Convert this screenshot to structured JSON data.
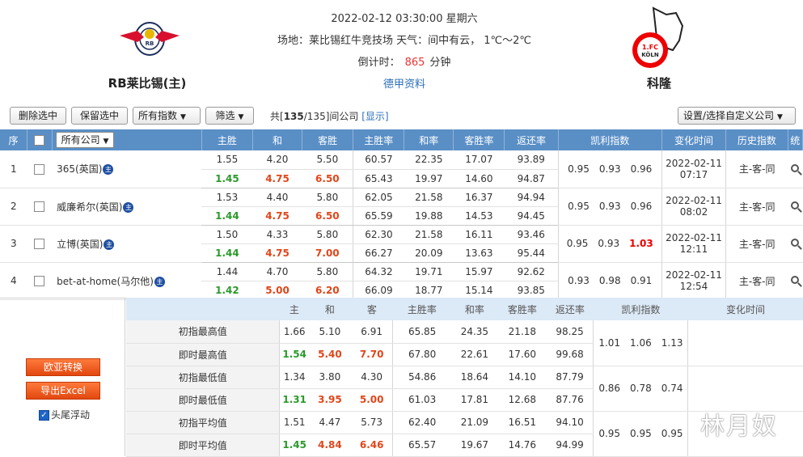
{
  "match": {
    "datetime": "2022-02-12 03:30:00 星期六",
    "venue_line": "场地：莱比锡红牛竞技场 天气：间中有云， 1℃～2℃",
    "countdown_label": "倒计时：",
    "countdown_value": "865",
    "countdown_unit": "分钟",
    "link": "德甲资料"
  },
  "home": {
    "name": "RB莱比锡(主)",
    "logo": "rb-leipzig-logo"
  },
  "away": {
    "name": "科隆",
    "logo": "fc-koln-logo"
  },
  "toolbar": {
    "delete_sel": "删除选中",
    "keep_sel": "保留选中",
    "all_index": "所有指数",
    "filter": "筛选",
    "count_pre": "共[",
    "count_a": "135",
    "count_mid": "/135]间公司",
    "show_link": "[显示]",
    "settings": "设置/选择自定义公司"
  },
  "columns": {
    "no": "序",
    "company": "所有公司",
    "home_win": "主胜",
    "draw": "和",
    "away_win": "客胜",
    "home_rate": "主胜率",
    "draw_rate": "和率",
    "away_rate": "客胜率",
    "return": "返还率",
    "kelly": "凯利指数",
    "change_time": "变化时间",
    "history": "历史指数",
    "stat": "统"
  },
  "rows": [
    {
      "no": "1",
      "company": "365(英国)",
      "init": [
        "1.55",
        "4.20",
        "5.50",
        "60.57",
        "22.35",
        "17.07",
        "93.89"
      ],
      "live": [
        "1.45",
        "4.75",
        "6.50",
        "65.43",
        "19.97",
        "14.60",
        "94.87"
      ],
      "kelly": [
        "0.95",
        "0.93",
        "0.96"
      ],
      "date": "2022-02-11",
      "time": "07:17",
      "history": "主-客-同"
    },
    {
      "no": "2",
      "company": "威廉希尔(英国)",
      "init": [
        "1.53",
        "4.40",
        "5.80",
        "62.05",
        "21.58",
        "16.37",
        "94.94"
      ],
      "live": [
        "1.44",
        "4.75",
        "6.50",
        "65.59",
        "19.88",
        "14.53",
        "94.45"
      ],
      "kelly": [
        "0.95",
        "0.93",
        "0.96"
      ],
      "date": "2022-02-11",
      "time": "08:02",
      "history": "主-客-同"
    },
    {
      "no": "3",
      "company": "立博(英国)",
      "init": [
        "1.50",
        "4.33",
        "5.80",
        "62.30",
        "21.58",
        "16.11",
        "93.46"
      ],
      "live": [
        "1.44",
        "4.75",
        "7.00",
        "66.27",
        "20.09",
        "13.63",
        "95.44"
      ],
      "kelly": [
        "0.95",
        "0.93",
        "1.03"
      ],
      "date": "2022-02-11",
      "time": "12:11",
      "history": "主-客-同"
    },
    {
      "no": "4",
      "company": "bet-at-home(马尔他)",
      "init": [
        "1.44",
        "4.70",
        "5.80",
        "64.32",
        "19.71",
        "15.97",
        "92.62"
      ],
      "live": [
        "1.42",
        "5.00",
        "6.20",
        "66.09",
        "18.77",
        "15.14",
        "93.85"
      ],
      "kelly": [
        "0.93",
        "0.98",
        "0.91"
      ],
      "date": "2022-02-11",
      "time": "12:54",
      "history": "主-客-同"
    }
  ],
  "summary": {
    "cols": {
      "home": "主",
      "draw": "和",
      "away": "客",
      "home_rate": "主胜率",
      "draw_rate": "和率",
      "away_rate": "客胜率",
      "return": "返还率",
      "kelly": "凯利指数",
      "change_time": "变化时间"
    },
    "rows": [
      {
        "label": "初指最高值",
        "vals": [
          "1.66",
          "5.10",
          "6.91",
          "65.85",
          "24.35",
          "21.18",
          "98.25"
        ]
      },
      {
        "label": "即时最高值",
        "vals": [
          "1.54",
          "5.40",
          "7.70",
          "67.80",
          "22.61",
          "17.60",
          "99.68"
        ]
      },
      {
        "label": "初指最低值",
        "vals": [
          "1.34",
          "3.80",
          "4.30",
          "54.86",
          "18.64",
          "14.10",
          "87.79"
        ]
      },
      {
        "label": "即时最低值",
        "vals": [
          "1.31",
          "3.95",
          "5.00",
          "61.03",
          "17.81",
          "12.68",
          "87.76"
        ]
      },
      {
        "label": "初指平均值",
        "vals": [
          "1.51",
          "4.47",
          "5.73",
          "62.40",
          "21.09",
          "16.51",
          "94.10"
        ]
      },
      {
        "label": "即时平均值",
        "vals": [
          "1.45",
          "4.84",
          "6.46",
          "65.57",
          "19.67",
          "14.76",
          "94.99"
        ]
      }
    ],
    "kelly": [
      [
        "1.01",
        "1.06",
        "1.13"
      ],
      [
        "0.86",
        "0.78",
        "0.74"
      ],
      [
        "0.95",
        "0.95",
        "0.95"
      ]
    ]
  },
  "sidebar": {
    "euro_convert": "欧亚转换",
    "export": "导出Excel",
    "float_label": "头尾浮动"
  },
  "watermark": "林月奴",
  "colors": {
    "header_blue": "#5a8fc6",
    "green": "#2a9a2a",
    "orange": "#e0461a",
    "red": "#e00000"
  }
}
